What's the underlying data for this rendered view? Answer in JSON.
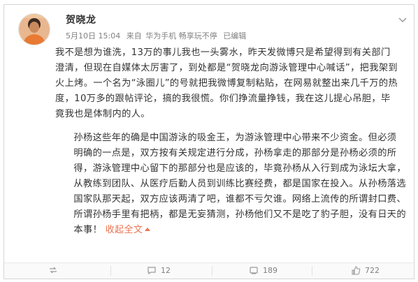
{
  "post": {
    "username": "贺晓龙",
    "meta": {
      "time": "5月10日 15:04",
      "source_prefix": "来自",
      "source": "华为手机 畅享玩不停",
      "edited": "已编辑"
    },
    "paragraph1": [
      "我不是想为谁洗，13万的事儿我也一头雾水，昨天发微博只是希望得到有关部门",
      "澄清，但现在自媒体太厉害了，到处都是“贺晓龙向游泳管理中心喊话”，把我架到",
      "火上烤。一个名为“泳圈儿”的号就把我微博复制粘贴，在网易就整出来几千万的热",
      "度，10万多的跟帖评论，搞的我很慌。你们挣流量挣钱，我在这儿提心吊胆，毕",
      "竟我也是体制内的人。"
    ],
    "paragraph2": [
      "孙杨这些年的确是中国游泳的吸金王，为游泳管理中心带来不少资金。但必须",
      "明确的一点是，双方按有关规定进行分成，孙杨拿走的那部分是孙杨必须的所",
      "得，游泳管理中心留下的那部分也是应该的，毕竟孙杨从入行到成为泳坛大拿，",
      "从教练到团队、从医疗后勤人员到训练比赛经费，都是国家在投入。从孙杨落选",
      "国家队那天起，双方应该两清了吧，谁都不亏欠谁。网络上流传的所谓封口费、",
      "所谓孙杨手里有把柄，都是无妄猜测，孙杨他们又不是吃了豹子胆，没有日天的"
    ],
    "paragraph2_last": "本事！",
    "collapse_label": "收起全文"
  },
  "footer": {
    "comments": "12",
    "reposts": "189",
    "likes": "722"
  },
  "colors": {
    "collapse": "#eb7350",
    "meta": "#808080",
    "text": "#333333"
  }
}
